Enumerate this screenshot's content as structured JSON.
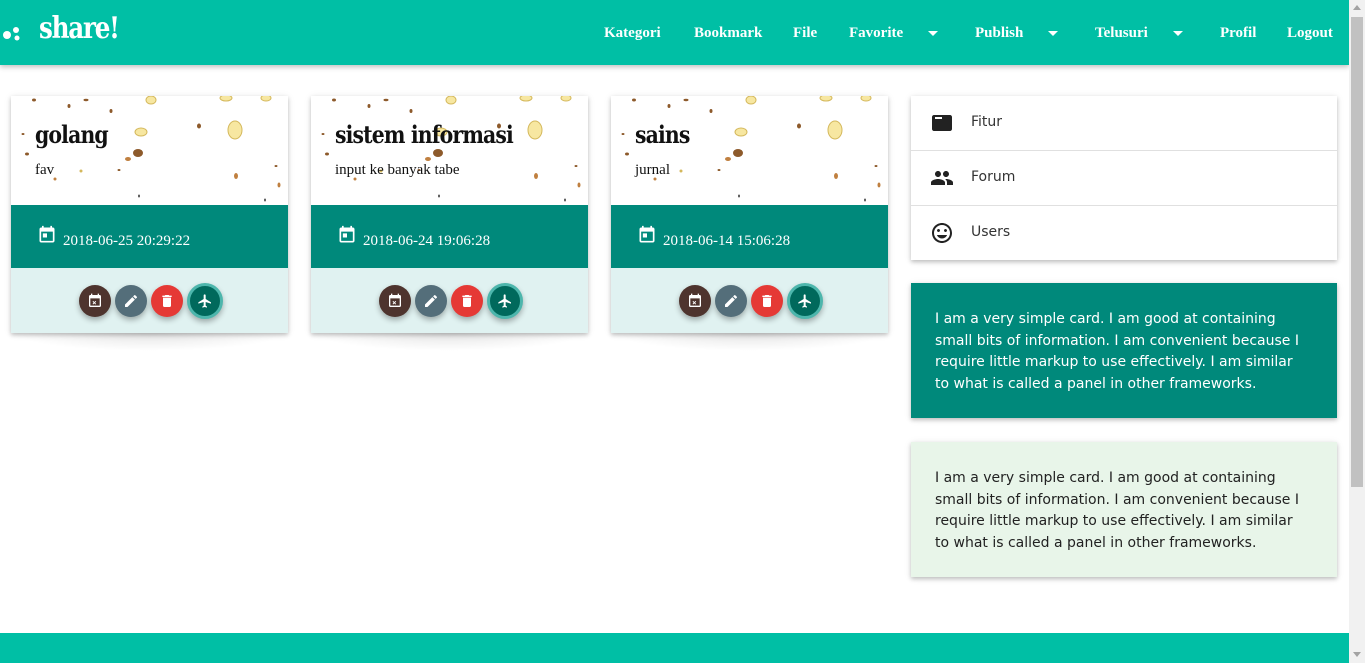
{
  "brand": {
    "title": "share!"
  },
  "nav": {
    "kategori": "Kategori",
    "bookmark": "Bookmark",
    "file": "File",
    "favorite": "Favorite",
    "publish": "Publish",
    "telusuri": "Telusuri",
    "profil": "Profil",
    "logout": "Logout"
  },
  "cards": [
    {
      "title": "golang",
      "description": "fav",
      "date": "2018-06-25 20:29:22"
    },
    {
      "title": "sistem informasi",
      "description": "input ke banyak tabe",
      "date": "2018-06-24 19:06:28"
    },
    {
      "title": "sains",
      "description": "jurnal",
      "date": "2018-06-14 15:06:28"
    }
  ],
  "card_actions": [
    {
      "icon": "calendar-remove-icon",
      "color": "#4e342e"
    },
    {
      "icon": "pencil-icon",
      "color": "#546e7a"
    },
    {
      "icon": "trash-icon",
      "color": "#e53935"
    },
    {
      "icon": "airplane-icon",
      "color": "#00695c"
    }
  ],
  "sidebar": {
    "items": [
      {
        "label": "Fitur",
        "icon": "web-asset-icon"
      },
      {
        "label": "Forum",
        "icon": "people-icon"
      },
      {
        "label": "Users",
        "icon": "smiley-icon"
      }
    ]
  },
  "info_cards": [
    {
      "text": "I am a very simple card. I am good at containing small bits of information. I am convenient because I require little markup to use effectively. I am similar to what is called a panel in other frameworks."
    },
    {
      "text": "I am a very simple card. I am good at containing small bits of information. I am convenient because I require little markup to use effectively. I am similar to what is called a panel in other frameworks."
    }
  ],
  "colors": {
    "primary": "#00bfa5",
    "card_band": "#00897b",
    "card_action_bg": "#e0f2f1",
    "info_light_bg": "#e8f5e9"
  }
}
